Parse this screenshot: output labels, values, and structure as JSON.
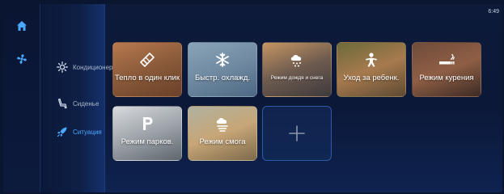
{
  "clock": "6:49",
  "rail": {
    "home_icon": "home-icon",
    "fan_icon": "fan-icon"
  },
  "menu": {
    "items": [
      {
        "label": "Кондиционер",
        "icon": "sun-gear-icon",
        "active": false
      },
      {
        "label": "Сиденье",
        "icon": "seat-icon",
        "active": false
      },
      {
        "label": "Ситуация",
        "icon": "rocket-icon",
        "active": true
      }
    ]
  },
  "tiles": [
    {
      "label": "Тепло в один клик",
      "icon": "wrench-icon"
    },
    {
      "label": "Быстр. охлажд.",
      "icon": "snowflake-icon"
    },
    {
      "label": "Режим дождя и снега",
      "icon": "cloud-snow-icon"
    },
    {
      "label": "Уход за ребенк.",
      "icon": "baby-icon"
    },
    {
      "label": "Режим курения",
      "icon": "cigarette-icon"
    },
    {
      "label": "Режим парков.",
      "icon": "parking-icon"
    },
    {
      "label": "Режим смога",
      "icon": "smog-icon"
    }
  ],
  "add_tile": {
    "icon": "plus-icon"
  },
  "colors": {
    "accent": "#4aa8ff",
    "background": "#0b1838"
  }
}
